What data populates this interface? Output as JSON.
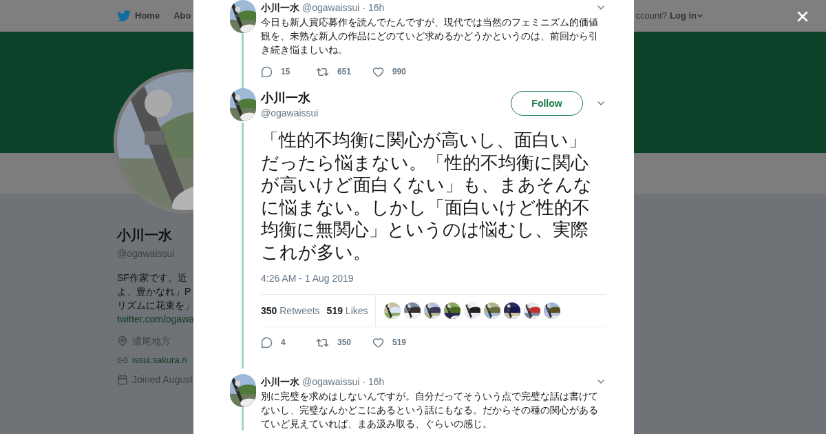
{
  "nav": {
    "items": [
      {
        "label": "Home"
      },
      {
        "label": "Abo"
      }
    ],
    "account_prompt": "ccount?",
    "login": "Log in"
  },
  "profile": {
    "name": "小川一水",
    "handle": "@ogawaissui",
    "bio": [
      "SF作家です。近",
      "よ、豊かなれ」P",
      "リズムに花束を」"
    ],
    "bio_link": "twitter.com/ogawa",
    "location": "濃尾地方",
    "website": "issui.sakura.n",
    "joined": "Joined August"
  },
  "tweets": [
    {
      "kind": "reply",
      "name": "小川一水",
      "handle": "@ogawaissui",
      "time": "· 16h",
      "text": "今日も新人賞応募作を読んでたんですが、現代では当然のフェミニズム的価値観を、未熟な新人の作品にどのていど求めるかどうかというのは、前回から引き続き悩ましいね。",
      "replies": "15",
      "retweets": "651",
      "likes": "990"
    },
    {
      "kind": "main",
      "name": "小川一水",
      "handle": "@ogawaissui",
      "follow": "Follow",
      "text": "「性的不均衡に関心が高いし、面白い」だったら悩まない。「性的不均衡に関心が高いけど面白くない」も、まあそんなに悩まない。しかし「面白いけど性的不均衡に無関心」というのは悩むし、実際これが多い。",
      "timestamp": "4:26 AM - 1 Aug 2019",
      "retweet_count": "350",
      "retweet_label": "Retweets",
      "like_count": "519",
      "like_label": "Likes",
      "replies": "4",
      "retweets": "350",
      "likes": "519"
    },
    {
      "kind": "reply",
      "name": "小川一水",
      "handle": "@ogawaissui",
      "time": "· 16h",
      "text": "別に完璧を求めはしないんですが。自分だってそういう点で完璧な話は書けてないし、完璧なんかどこにあるという話にもなる。だからその種の関心があるていど見えていれば、まあ汲み取る、ぐらいの感じ。"
    }
  ]
}
